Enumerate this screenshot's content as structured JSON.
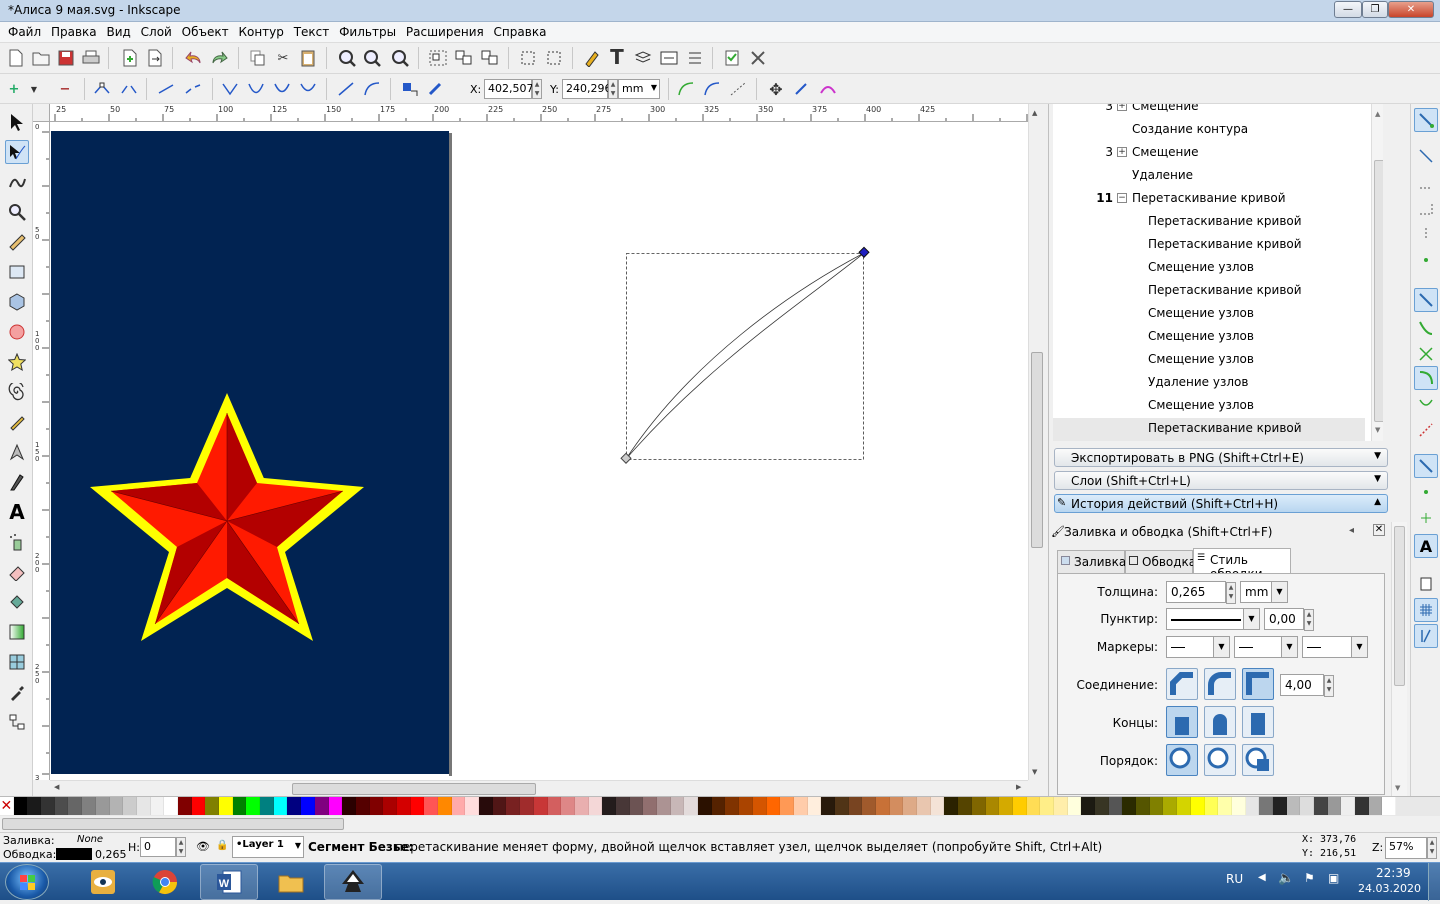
{
  "window": {
    "title": "*Алиса 9 мая.svg - Inkscape",
    "min": "—",
    "max": "❐",
    "close": "✕"
  },
  "menu": [
    "Файл",
    "Правка",
    "Вид",
    "Слой",
    "Объект",
    "Контур",
    "Текст",
    "Фильтры",
    "Расширения",
    "Справка"
  ],
  "toolctrl": {
    "x_label": "X:",
    "x_value": "402,507",
    "y_label": "Y:",
    "y_value": "240,296",
    "unit": "mm"
  },
  "ruler_top": [
    "25",
    "50",
    "75",
    "100",
    "125",
    "150",
    "175",
    "200",
    "225",
    "250",
    "275",
    "300",
    "325",
    "350",
    "375",
    "400",
    "425"
  ],
  "ruler_left": [
    "0",
    "5",
    "0",
    "1",
    "0",
    "0",
    "1",
    "5",
    "0",
    "2",
    "0",
    "0",
    "2",
    "5",
    "0",
    "3",
    "0",
    "0",
    "3",
    "5",
    "0"
  ],
  "history": {
    "rows": [
      {
        "count": "3",
        "expander": "+",
        "text": "Смещение"
      },
      {
        "count": "",
        "expander": "",
        "text": "Создание контура"
      },
      {
        "count": "3",
        "expander": "+",
        "text": "Смещение"
      },
      {
        "count": "",
        "expander": "",
        "text": "Удаление"
      },
      {
        "count": "11",
        "expander": "−",
        "text": "Перетаскивание кривой"
      },
      {
        "count": "",
        "expander": "",
        "text": "Перетаскивание кривой"
      },
      {
        "count": "",
        "expander": "",
        "text": "Перетаскивание кривой"
      },
      {
        "count": "",
        "expander": "",
        "text": "Смещение узлов"
      },
      {
        "count": "",
        "expander": "",
        "text": "Перетаскивание кривой"
      },
      {
        "count": "",
        "expander": "",
        "text": "Смещение узлов"
      },
      {
        "count": "",
        "expander": "",
        "text": "Смещение узлов"
      },
      {
        "count": "",
        "expander": "",
        "text": "Смещение узлов"
      },
      {
        "count": "",
        "expander": "",
        "text": "Удаление узлов"
      },
      {
        "count": "",
        "expander": "",
        "text": "Смещение узлов"
      },
      {
        "count": "",
        "expander": "",
        "text": "Перетаскивание кривой"
      }
    ]
  },
  "dock": {
    "export": "Экспортировать в PNG (Shift+Ctrl+E)",
    "layers": "Слои (Shift+Ctrl+L)",
    "history": "История действий (Shift+Ctrl+H)",
    "fillstroke_title": "Заливка и обводка (Shift+Ctrl+F)",
    "tabs": {
      "fill": "Заливка",
      "stroke": "Обводка",
      "style": "Стиль обводки"
    },
    "width_label": "Толщина:",
    "width_value": "0,265",
    "width_unit": "mm",
    "dash_label": "Пунктир:",
    "dash_value": "0,00",
    "markers_label": "Маркеры:",
    "join_label": "Соединение:",
    "miter_value": "4,00",
    "caps_label": "Концы:",
    "order_label": "Порядок:"
  },
  "status": {
    "fill_label": "Заливка:",
    "fill_value": "None",
    "stroke_label": "Обводка:",
    "stroke_width": "0,265",
    "h_label": "H:",
    "h_value": "0",
    "layer": "•Layer 1",
    "message_bold": "Сегмент Безье:",
    "message": " перетаскивание меняет форму, двойной щелчок вставляет узел, щелчок выделяет (попробуйте Shift, Ctrl+Alt)",
    "x_label": "X:",
    "x_value": "373,76",
    "y_label": "Y:",
    "y_value": "216,51",
    "z_label": "Z:",
    "zoom": "57%"
  },
  "taskbar": {
    "lang": "RU",
    "time": "22:39",
    "date": "24.03.2020"
  },
  "colors": {
    "doc_bg": "#012352",
    "star_outline": "#ffff00",
    "star_fill": "#ff1a00",
    "star_dark": "#b30000",
    "accent": "#3a6ea8"
  }
}
